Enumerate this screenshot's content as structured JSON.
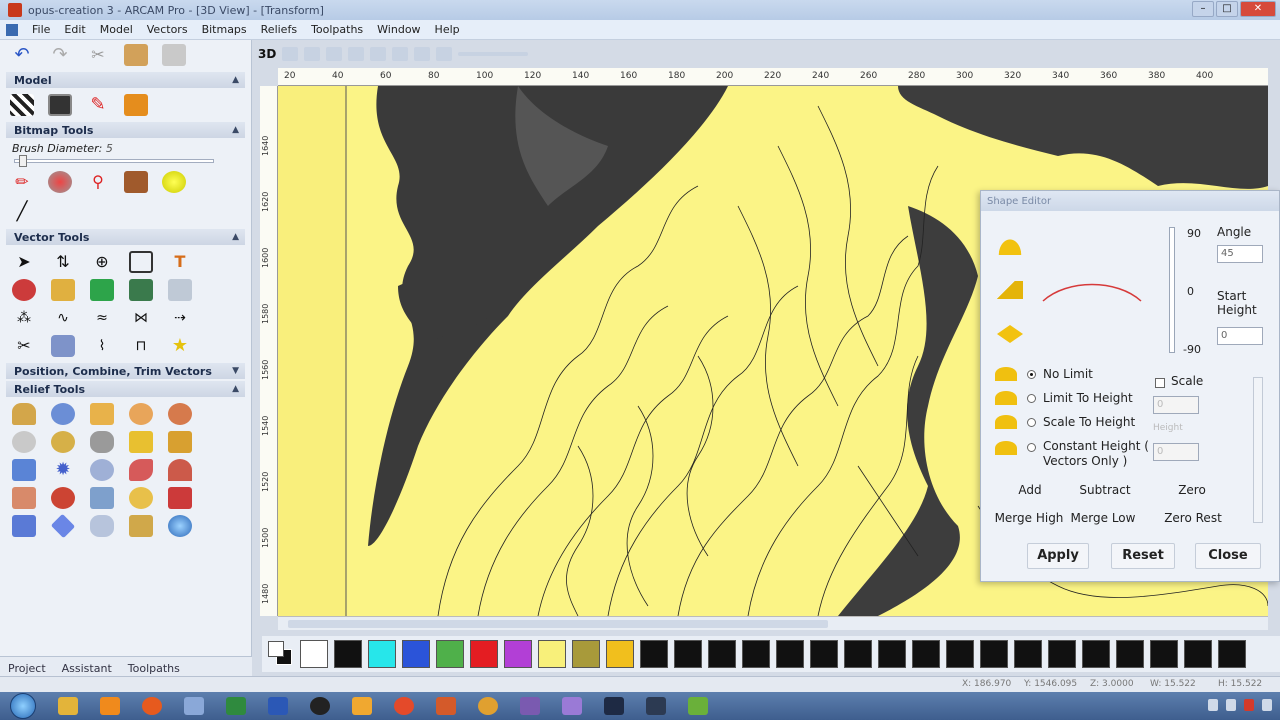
{
  "window": {
    "title": "opus-creation 3 - ARCAM Pro - [3D View] - [Transform]"
  },
  "menu": [
    "File",
    "Edit",
    "Model",
    "Vectors",
    "Bitmaps",
    "Reliefs",
    "Toolpaths",
    "Window",
    "Help"
  ],
  "toolbar3d": {
    "view_label": "3D"
  },
  "panels": {
    "model": "Model",
    "bitmap_tools": "Bitmap Tools",
    "brush_label": "Brush Diameter:",
    "brush_value": "5",
    "vector_tools": "Vector Tools",
    "position_tools": "Position, Combine, Trim Vectors",
    "relief_tools": "Relief Tools"
  },
  "left_tabs": [
    "Project",
    "Assistant",
    "Toolpaths"
  ],
  "ruler": {
    "top_ticks": [
      "20",
      "40",
      "60",
      "80",
      "100",
      "120",
      "140",
      "160",
      "180",
      "200",
      "220",
      "240",
      "260",
      "280",
      "300",
      "320",
      "340",
      "360",
      "380",
      "400"
    ],
    "left_ticks": [
      "1640",
      "1620",
      "1600",
      "1580",
      "1560",
      "1540",
      "1520",
      "1500",
      "1480"
    ]
  },
  "shape_editor": {
    "title": "Shape Editor",
    "angle_label": "Angle",
    "angle_value": "45",
    "start_height_label": "Start Height",
    "start_height_value": "0",
    "slider_top": "90",
    "slider_mid": "0",
    "slider_bottom": "-90",
    "options": [
      "No Limit",
      "Limit To Height",
      "Scale To Height",
      "Constant Height ( Vectors Only )"
    ],
    "scale_label": "Scale",
    "scale_value": "0",
    "limit_value": "0",
    "scale_height_value": "0",
    "height_field": "Height",
    "constant_value": "0",
    "buttons_row1": [
      "Add",
      "Subtract",
      "Zero"
    ],
    "buttons_row2": [
      "Merge High",
      "Merge Low",
      "Zero Rest"
    ],
    "apply": "Apply",
    "reset": "Reset",
    "close": "Close"
  },
  "palette": {
    "colors": [
      "#ffffff",
      "#111111",
      "#27e6ea",
      "#2b54d9",
      "#4fb04a",
      "#e41d22",
      "#b23fd6",
      "#f8f07a",
      "#a89a3a",
      "#f1bf1d",
      "#111111",
      "#111111",
      "#111111",
      "#111111",
      "#111111",
      "#111111",
      "#111111",
      "#111111",
      "#111111",
      "#111111",
      "#111111",
      "#111111",
      "#111111",
      "#111111",
      "#111111",
      "#111111",
      "#111111",
      "#111111"
    ]
  },
  "status": {
    "x": "X: 186.970",
    "y": "Y: 1546.095",
    "z": "Z: 3.0000",
    "w": "W: 15.522",
    "h": "H: 15.522"
  }
}
